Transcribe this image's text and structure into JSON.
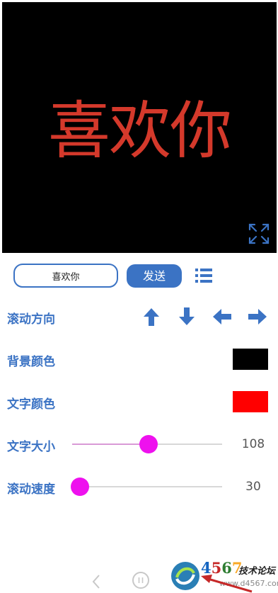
{
  "preview": {
    "text": "喜欢你"
  },
  "controls": {
    "input_value": "喜欢你",
    "send_label": "发送"
  },
  "rows": {
    "direction_label": "滚动方向",
    "bg_label": "背景颜色",
    "text_color_label": "文字颜色",
    "size_label": "文字大小",
    "speed_label": "滚动速度"
  },
  "colors": {
    "background": "#000000",
    "text": "#ff0000",
    "accent": "#3b73c4",
    "thumb": "#ee11ee"
  },
  "sliders": {
    "size": {
      "value": "108",
      "fraction": 0.51
    },
    "speed": {
      "value": "30",
      "fraction": 0.05
    }
  },
  "watermark": {
    "number": "4567",
    "site_cn": "技术论坛",
    "url": "www.d4567.com"
  }
}
